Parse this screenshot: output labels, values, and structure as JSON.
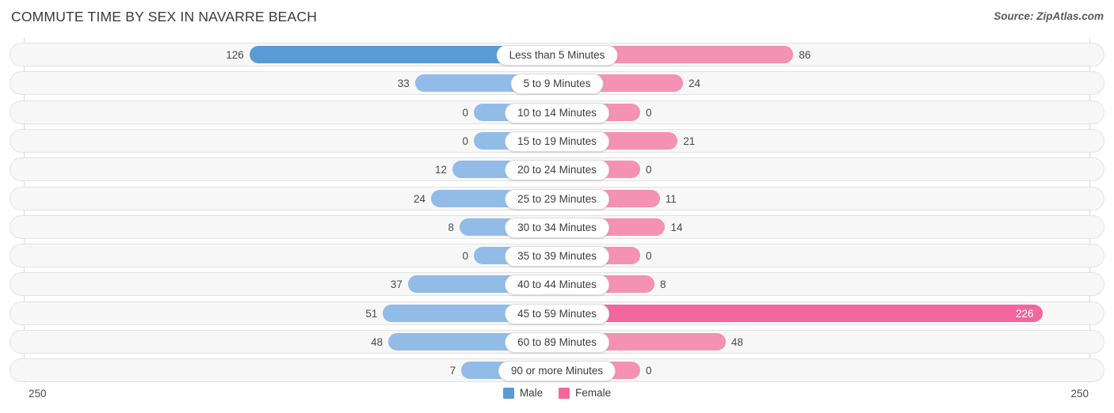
{
  "header": {
    "title": "COMMUTE TIME BY SEX IN NAVARRE BEACH",
    "source": "Source: ZipAtlas.com"
  },
  "axis": {
    "min_left": "250",
    "min_right": "250",
    "max_value": 250
  },
  "legend": {
    "items": [
      {
        "label": "Male",
        "color": "#5b9bd5"
      },
      {
        "label": "Female",
        "color": "#f2679d"
      }
    ]
  },
  "colors": {
    "male_max": "#5b9bd5",
    "male": "#92bce8",
    "female_max": "#f2679d",
    "female": "#f591b2",
    "track_bg": "#f7f7f7",
    "track_border": "#e3e3e3",
    "gridline": "#d8d8d8"
  },
  "chart_data": {
    "type": "bar",
    "title": "COMMUTE TIME BY SEX IN NAVARRE BEACH",
    "subtitle": "Source: ZipAtlas.com",
    "orientation": "horizontal-diverging",
    "xlabel": "",
    "ylabel": "",
    "axis_range": [
      0,
      250
    ],
    "grid": true,
    "legend_position": "bottom-center",
    "categories": [
      "Less than 5 Minutes",
      "5 to 9 Minutes",
      "10 to 14 Minutes",
      "15 to 19 Minutes",
      "20 to 24 Minutes",
      "25 to 29 Minutes",
      "30 to 34 Minutes",
      "35 to 39 Minutes",
      "40 to 44 Minutes",
      "45 to 59 Minutes",
      "60 to 89 Minutes",
      "90 or more Minutes"
    ],
    "series": [
      {
        "name": "Male",
        "values": [
          126,
          33,
          0,
          0,
          12,
          24,
          8,
          0,
          37,
          51,
          48,
          7
        ]
      },
      {
        "name": "Female",
        "values": [
          86,
          24,
          0,
          21,
          0,
          11,
          14,
          0,
          8,
          226,
          48,
          0
        ]
      }
    ]
  },
  "rows": [
    {
      "category": "Less than 5 Minutes",
      "male": "126",
      "female": "86"
    },
    {
      "category": "5 to 9 Minutes",
      "male": "33",
      "female": "24"
    },
    {
      "category": "10 to 14 Minutes",
      "male": "0",
      "female": "0"
    },
    {
      "category": "15 to 19 Minutes",
      "male": "0",
      "female": "21"
    },
    {
      "category": "20 to 24 Minutes",
      "male": "12",
      "female": "0"
    },
    {
      "category": "25 to 29 Minutes",
      "male": "24",
      "female": "11"
    },
    {
      "category": "30 to 34 Minutes",
      "male": "8",
      "female": "14"
    },
    {
      "category": "35 to 39 Minutes",
      "male": "0",
      "female": "0"
    },
    {
      "category": "40 to 44 Minutes",
      "male": "37",
      "female": "8"
    },
    {
      "category": "45 to 59 Minutes",
      "male": "51",
      "female": "226"
    },
    {
      "category": "60 to 89 Minutes",
      "male": "48",
      "female": "48"
    },
    {
      "category": "90 or more Minutes",
      "male": "7",
      "female": "0"
    }
  ]
}
